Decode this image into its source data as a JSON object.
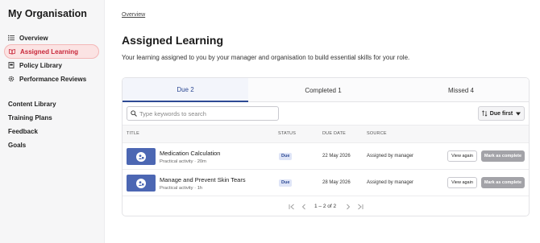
{
  "sidebar": {
    "title": "My Organisation",
    "primary_items": [
      {
        "label": "Overview",
        "icon": "list-icon"
      },
      {
        "label": "Assigned Learning",
        "icon": "book-icon",
        "active": true
      },
      {
        "label": "Policy Library",
        "icon": "document-icon"
      },
      {
        "label": "Performance Reviews",
        "icon": "gear-icon"
      }
    ],
    "secondary_items": [
      {
        "label": "Content Library"
      },
      {
        "label": "Training Plans"
      },
      {
        "label": "Feedback"
      },
      {
        "label": "Goals"
      }
    ]
  },
  "breadcrumb": "Overview",
  "page": {
    "title": "Assigned Learning",
    "description": "Your learning assigned to you by your manager and organisation to build essential skills for your role."
  },
  "tabs": [
    {
      "label": "Due 2",
      "active": true
    },
    {
      "label": "Completed 1",
      "active": false
    },
    {
      "label": "Missed 4",
      "active": false
    }
  ],
  "search": {
    "placeholder": "Type keywords to search",
    "value": ""
  },
  "sort": {
    "label": "Due first"
  },
  "table": {
    "columns": [
      "TITLE",
      "STATUS",
      "DUE DATE",
      "SOURCE"
    ],
    "rows": [
      {
        "title": "Medication Calculation",
        "subtitle": "Practical activity · 20m",
        "status": "Due",
        "due_date": "22 May 2026",
        "source": "Assigned by manager",
        "action_secondary": "View again",
        "action_primary": "Mark as complete"
      },
      {
        "title": "Manage and Prevent Skin Tears",
        "subtitle": "Practical activity · 1h",
        "status": "Due",
        "due_date": "28 May 2026",
        "source": "Assigned by manager",
        "action_secondary": "View again",
        "action_primary": "Mark as complete"
      }
    ]
  },
  "pagination": {
    "text": "1 – 2 of 2"
  },
  "colors": {
    "accent": "#2e4a94",
    "active_nav_bg": "#fbe3e3",
    "active_nav_text": "#c8283a",
    "thumb_bg": "#4c67b3",
    "disabled_button": "#a3a3a8"
  }
}
